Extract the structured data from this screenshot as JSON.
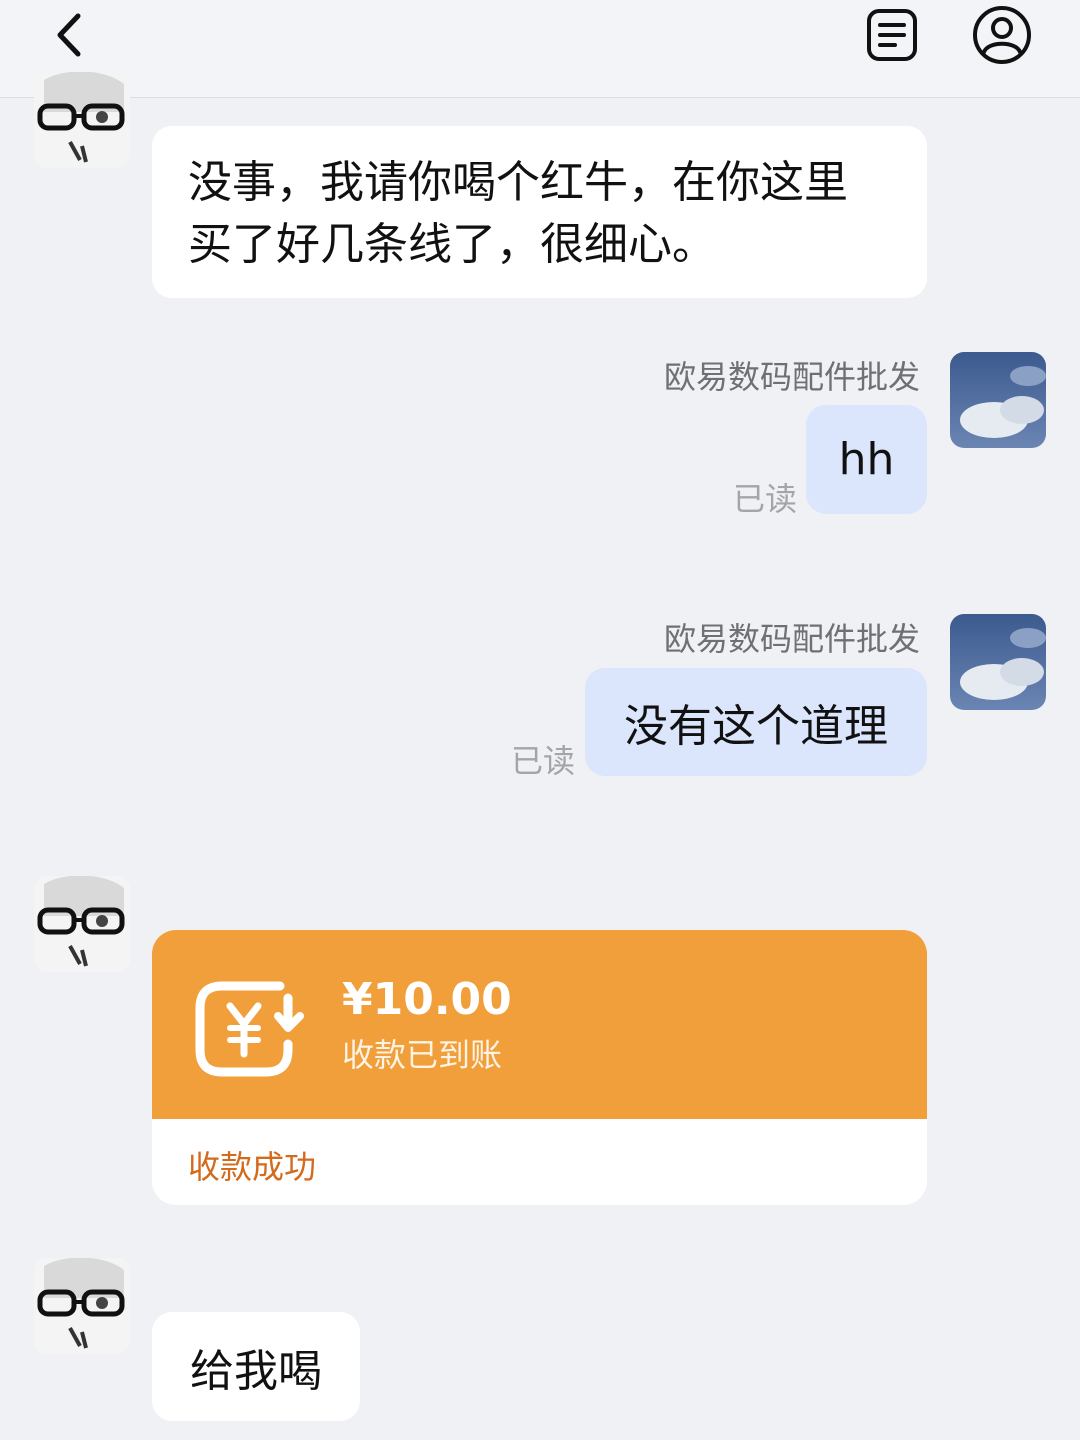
{
  "colors": {
    "background": "#f0f1f5",
    "incoming_bubble": "#ffffff",
    "outgoing_bubble": "#dbe5fb",
    "transfer_card": "#f09f3b",
    "transfer_footer_text": "#d36a1c"
  },
  "header": {
    "icons": [
      "chevron-left-icon",
      "notes-icon",
      "user-profile-icon"
    ]
  },
  "messages": [
    {
      "side": "incoming",
      "text_line1": "没事，我请你喝个红牛，在你这里",
      "text_line2": "买了好几条线了，很细心。"
    },
    {
      "side": "outgoing",
      "sender": "欧易数码配件批发",
      "text": "hh",
      "read_status": "已读"
    },
    {
      "side": "outgoing",
      "sender": "欧易数码配件批发",
      "text": "没有这个道理",
      "read_status": "已读"
    },
    {
      "side": "incoming",
      "type": "transfer",
      "amount": "¥10.00",
      "status": "收款已到账",
      "footer": "收款成功",
      "icon": "yuan-transfer-icon"
    },
    {
      "side": "incoming",
      "text": "给我喝"
    }
  ]
}
